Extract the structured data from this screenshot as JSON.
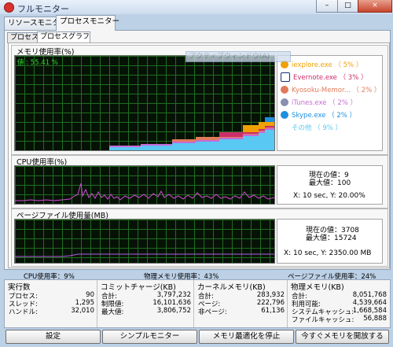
{
  "window": {
    "title": "フルモニター",
    "minimize_glyph": "–",
    "maximize_glyph": "□",
    "close_glyph": "×"
  },
  "tabs": [
    {
      "label": "リソースモニター"
    },
    {
      "label": "プロセスモニター"
    }
  ],
  "subtabs": [
    {
      "label": "プロセス"
    },
    {
      "label": "プロセスグラフ"
    }
  ],
  "overlay_hint": "アクティブウィンドウ(A)",
  "memory_group": {
    "label": "メモリ使用率(%)",
    "graph_value": "値 : 55.41 %",
    "legend": [
      {
        "icon": "internet-explorer-icon",
        "color": "#f0a000",
        "text": "iexplore.exe （ 5% ）"
      },
      {
        "icon": "evernote-icon",
        "color": "#cc2e6a",
        "text": "Evernote.exe （ 3% ）"
      },
      {
        "icon": "kyosoku-icon",
        "color": "#e07b5a",
        "text": "Kyosoku-Memor... （ 2% ）"
      },
      {
        "icon": "itunes-icon",
        "color": "#c86ad8",
        "text": "iTunes.exe （ 2% ）"
      },
      {
        "icon": "skype-icon",
        "color": "#1d8fe0",
        "text": "Skype.exe （ 2% ）"
      },
      {
        "icon": "other-icon",
        "color": "#59c8f2",
        "text": "その他 （ 9% ）"
      }
    ]
  },
  "cpu_group": {
    "label": "CPU使用率(%)",
    "current": "現在の値：9",
    "max": "最大値：100",
    "cursor": "X: 10 sec,  Y: 20.00%"
  },
  "pagefile_group": {
    "label": "ページファイル使用量(MB)",
    "current": "現在の値：3708",
    "max": "最大値：15724",
    "cursor": "X: 10 sec,  Y: 2350.00 MB"
  },
  "usage_strip": {
    "cpu": "CPU使用率：9%",
    "physical": "物理メモリ使用率：43%",
    "pagefile": "ページファイル使用率：24%"
  },
  "stats": {
    "exec": {
      "title": "実行数",
      "rows": [
        {
          "k": "プロセス:",
          "v": "90"
        },
        {
          "k": "スレッド:",
          "v": "1,295"
        },
        {
          "k": "ハンドル:",
          "v": "32,010"
        }
      ]
    },
    "commit": {
      "title": "コミットチャージ(KB)",
      "rows": [
        {
          "k": "合計:",
          "v": "3,797,232"
        },
        {
          "k": "制限値:",
          "v": "16,101,636"
        },
        {
          "k": "最大値:",
          "v": "3,806,752"
        }
      ]
    },
    "kernel": {
      "title": "カーネルメモリ(KB)",
      "rows": [
        {
          "k": "合計:",
          "v": "283,932"
        },
        {
          "k": "ページ:",
          "v": "222,796"
        },
        {
          "k": "非ページ:",
          "v": "61,136"
        }
      ]
    },
    "physical": {
      "title": "物理メモリ(KB)",
      "rows": [
        {
          "k": "合計:",
          "v": "8,051,768"
        },
        {
          "k": "利用可能:",
          "v": "4,539,664"
        },
        {
          "k": "システムキャッシュ:",
          "v": "1,668,584"
        },
        {
          "k": "ファイルキャッシュ:",
          "v": "56,888"
        }
      ]
    }
  },
  "buttons": {
    "settings": "設定",
    "simple": "シンプルモニター",
    "stop_opt": "メモリ最適化を停止",
    "free_now": "今すぐメモリを開放する"
  },
  "colors": {
    "graph_bg": "#071207",
    "grid": "#1f6d1f",
    "cpu_line": "#d24bd6",
    "page_line": "#b65ce0"
  }
}
